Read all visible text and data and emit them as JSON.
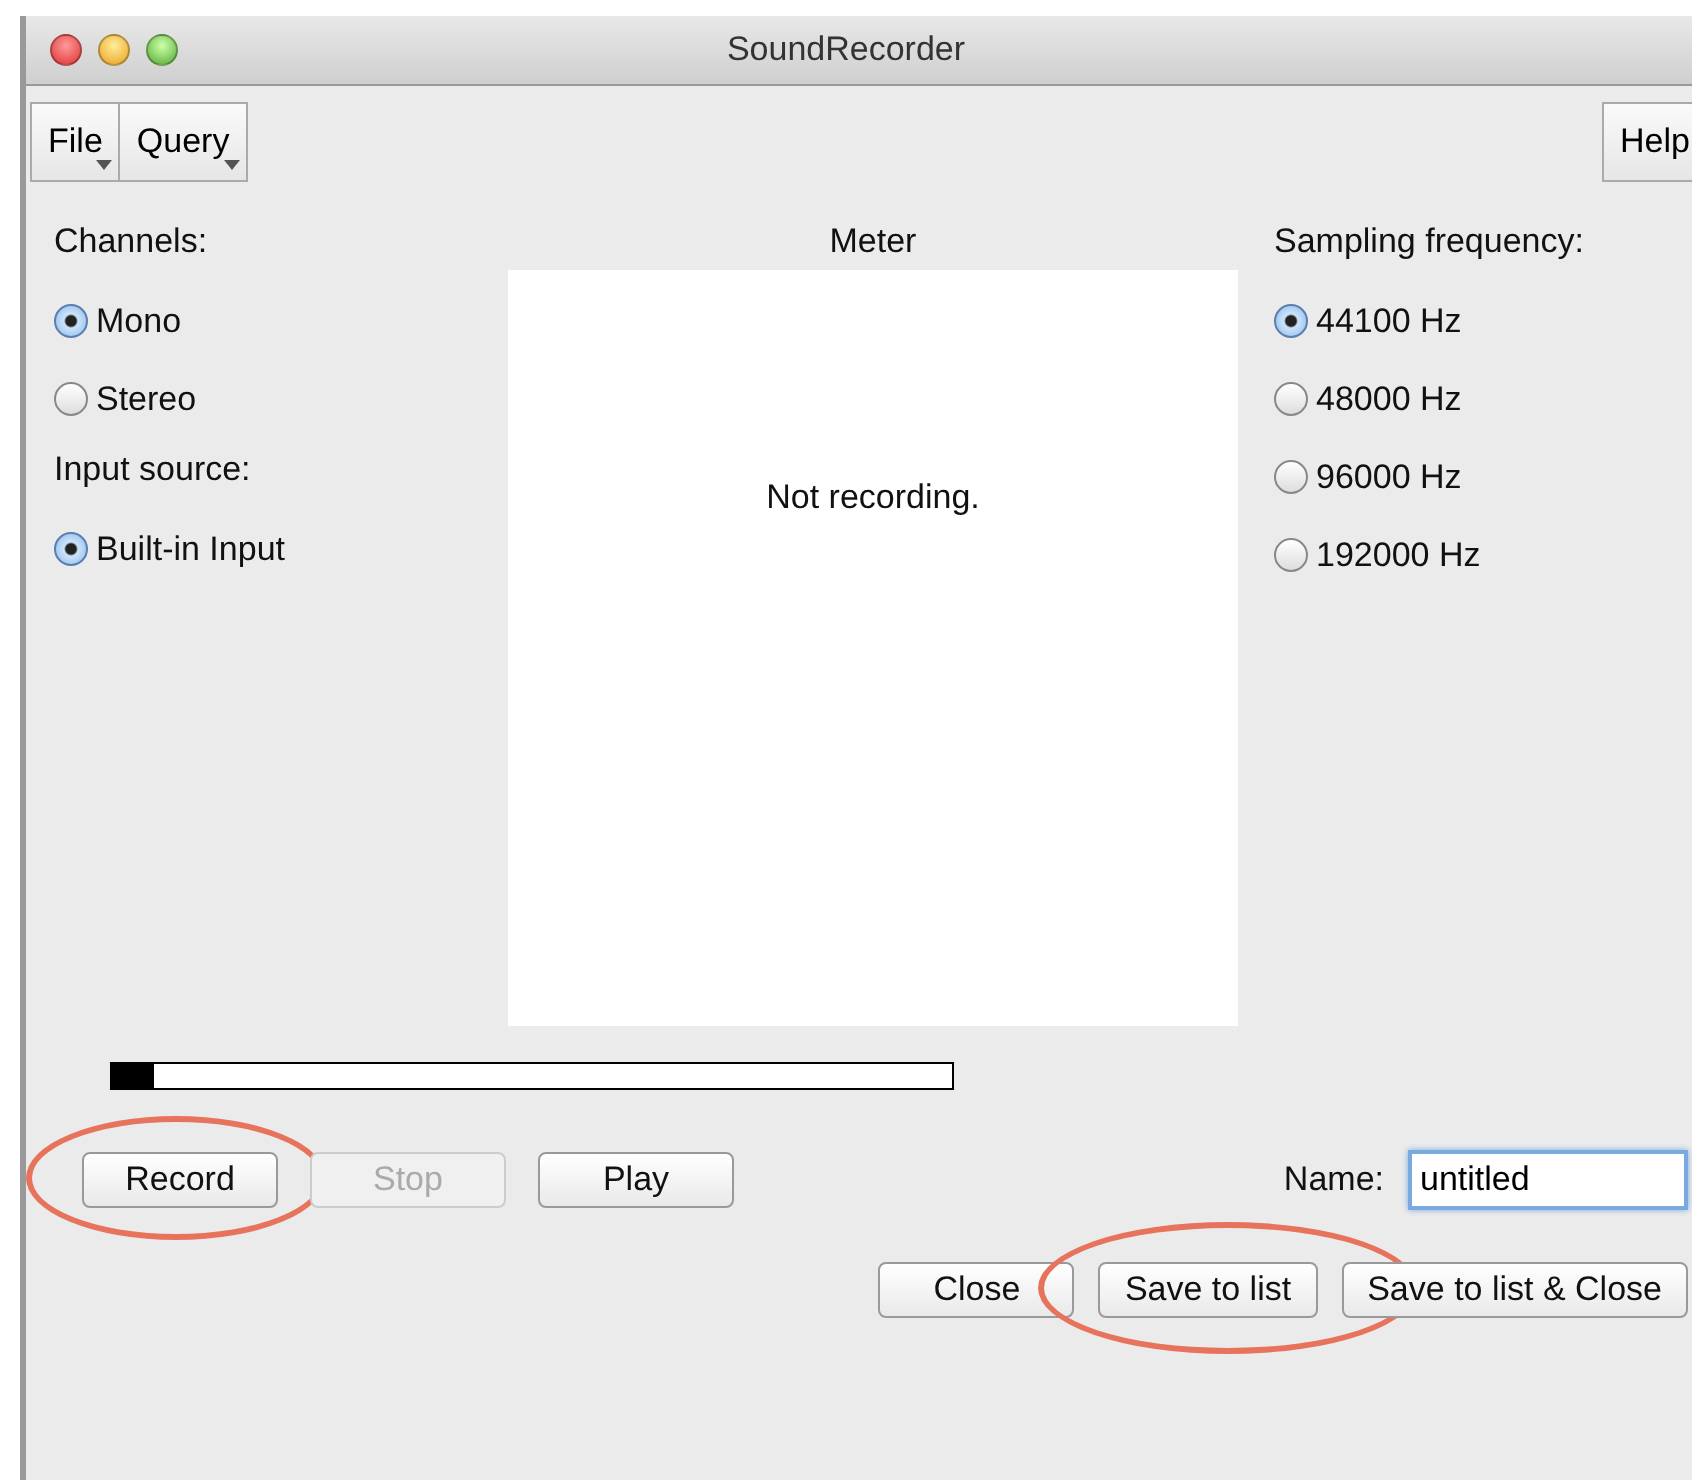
{
  "window": {
    "title": "SoundRecorder"
  },
  "menus": [
    {
      "label": "File"
    },
    {
      "label": "Query"
    }
  ],
  "help_menu": {
    "label": "Help"
  },
  "channels": {
    "label": "Channels:",
    "options": [
      {
        "label": "Mono",
        "selected": true
      },
      {
        "label": "Stereo",
        "selected": false
      }
    ]
  },
  "input_source": {
    "label": "Input source:",
    "options": [
      {
        "label": "Built-in Input",
        "selected": true
      }
    ]
  },
  "meter": {
    "title": "Meter",
    "status": "Not recording."
  },
  "sampling": {
    "label": "Sampling frequency:",
    "options": [
      {
        "label": "44100 Hz",
        "selected": true
      },
      {
        "label": "48000 Hz",
        "selected": false
      },
      {
        "label": "96000 Hz",
        "selected": false
      },
      {
        "label": "192000 Hz",
        "selected": false
      }
    ]
  },
  "progress": {
    "level": 0.05
  },
  "transport_buttons": [
    {
      "label": "Record",
      "disabled": false,
      "highlighted": true
    },
    {
      "label": "Stop",
      "disabled": true,
      "highlighted": false
    },
    {
      "label": "Play",
      "disabled": false,
      "highlighted": false
    }
  ],
  "name_field": {
    "label": "Name:",
    "value": "untitled"
  },
  "bottom_buttons": [
    {
      "label": "Close",
      "highlighted": false
    },
    {
      "label": "Save to list",
      "highlighted": true
    },
    {
      "label": "Save to list & Close",
      "highlighted": false
    }
  ]
}
